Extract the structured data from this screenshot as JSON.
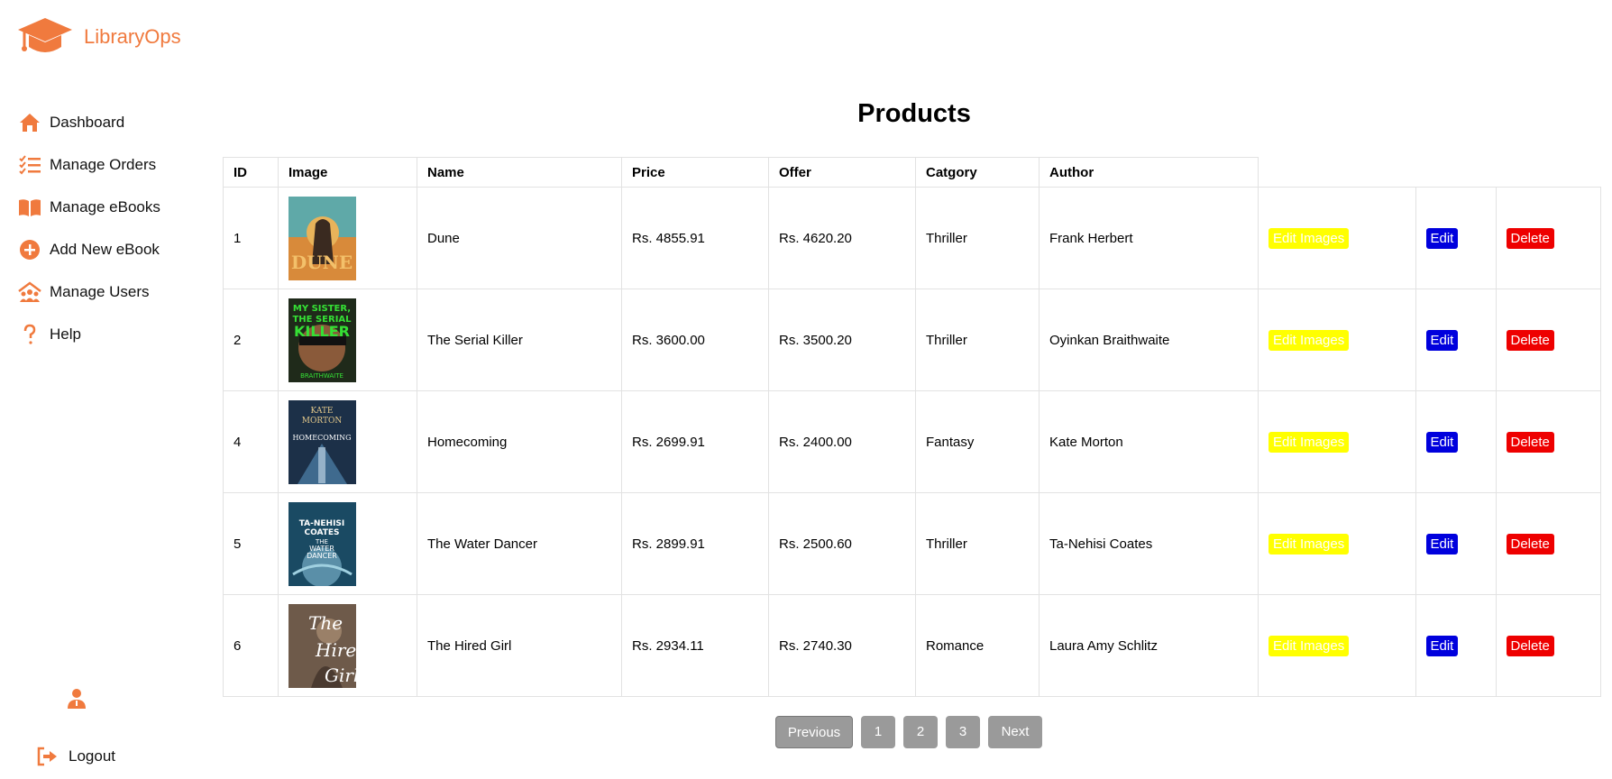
{
  "brand": {
    "name": "LibraryOps"
  },
  "sidebar": {
    "items": [
      {
        "label": "Dashboard",
        "icon": "home-icon"
      },
      {
        "label": "Manage Orders",
        "icon": "checklist-icon"
      },
      {
        "label": "Manage eBooks",
        "icon": "open-book-icon"
      },
      {
        "label": "Add New eBook",
        "icon": "plus-circle-icon"
      },
      {
        "label": "Manage Users",
        "icon": "users-icon"
      },
      {
        "label": "Help",
        "icon": "question-icon"
      }
    ],
    "logout_label": "Logout"
  },
  "page": {
    "title": "Products"
  },
  "table": {
    "columns": [
      "ID",
      "Image",
      "Name",
      "Price",
      "Offer",
      "Catgory",
      "Author"
    ],
    "rows": [
      {
        "id": "1",
        "name": "Dune",
        "price": "Rs. 4855.91",
        "offer": "Rs. 4620.20",
        "category": "Thriller",
        "author": "Frank Herbert"
      },
      {
        "id": "2",
        "name": "The Serial Killer",
        "price": "Rs. 3600.00",
        "offer": "Rs. 3500.20",
        "category": "Thriller",
        "author": "Oyinkan Braithwaite"
      },
      {
        "id": "4",
        "name": "Homecoming",
        "price": "Rs. 2699.91",
        "offer": "Rs. 2400.00",
        "category": "Fantasy",
        "author": "Kate Morton"
      },
      {
        "id": "5",
        "name": "The Water Dancer",
        "price": "Rs. 2899.91",
        "offer": "Rs. 2500.60",
        "category": "Thriller",
        "author": "Ta-Nehisi Coates"
      },
      {
        "id": "6",
        "name": "The Hired Girl",
        "price": "Rs. 2934.11",
        "offer": "Rs. 2740.30",
        "category": "Romance",
        "author": "Laura Amy Schlitz"
      }
    ],
    "actions": {
      "edit_images": "Edit Images",
      "edit": "Edit",
      "delete": "Delete"
    }
  },
  "pagination": {
    "previous": "Previous",
    "pages": [
      "1",
      "2",
      "3"
    ],
    "next": "Next"
  },
  "colors": {
    "accent": "#f07a3e",
    "edit_images_bg": "#ffff00",
    "edit_bg": "#0000dd",
    "delete_bg": "#ee0000",
    "pagination_bg": "#9a9a9a"
  }
}
